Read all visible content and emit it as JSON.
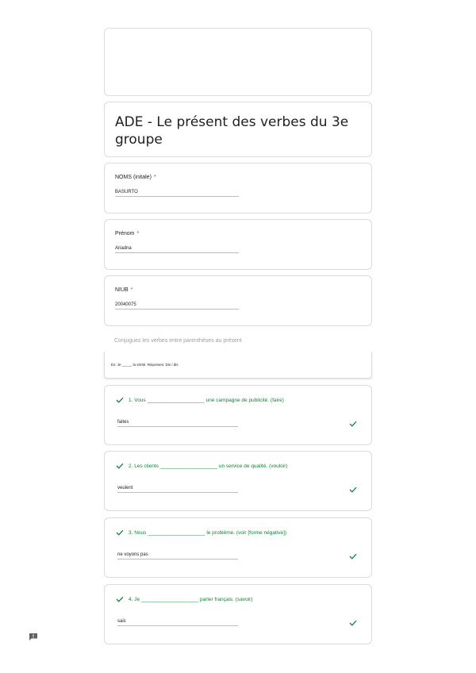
{
  "form": {
    "title": "ADE - Le présent des verbes du 3e groupe",
    "required_mark": "*"
  },
  "fields": [
    {
      "label": "NOMS (initale)",
      "value": "BASURTO"
    },
    {
      "label": "Prénom",
      "value": "Ariadna"
    },
    {
      "label": "NIUB",
      "value": "20040075"
    }
  ],
  "section": {
    "description": "Conjuguez les verbes entre parenthèses au présent",
    "example": "Ex: Je _____ la vérité. Réponses: Dis / dis"
  },
  "questions": [
    {
      "text": "1. Vous ____________________ une campagne de publicité. (faire)",
      "answer": "faites"
    },
    {
      "text": "2. Les clients ____________________ un service de qualité. (vouloir)",
      "answer": "veulent"
    },
    {
      "text": "3. Nous ____________________ le problème. (voir [forme négative])",
      "answer": "ne voyons pas"
    },
    {
      "text": "4. Je ____________________ parler français. (savoir)",
      "answer": "sais"
    }
  ],
  "colors": {
    "correct": "#188038",
    "required": "#d93025",
    "border": "#dadce0"
  },
  "icons": {
    "correct": "check-icon",
    "report": "feedback-icon"
  }
}
